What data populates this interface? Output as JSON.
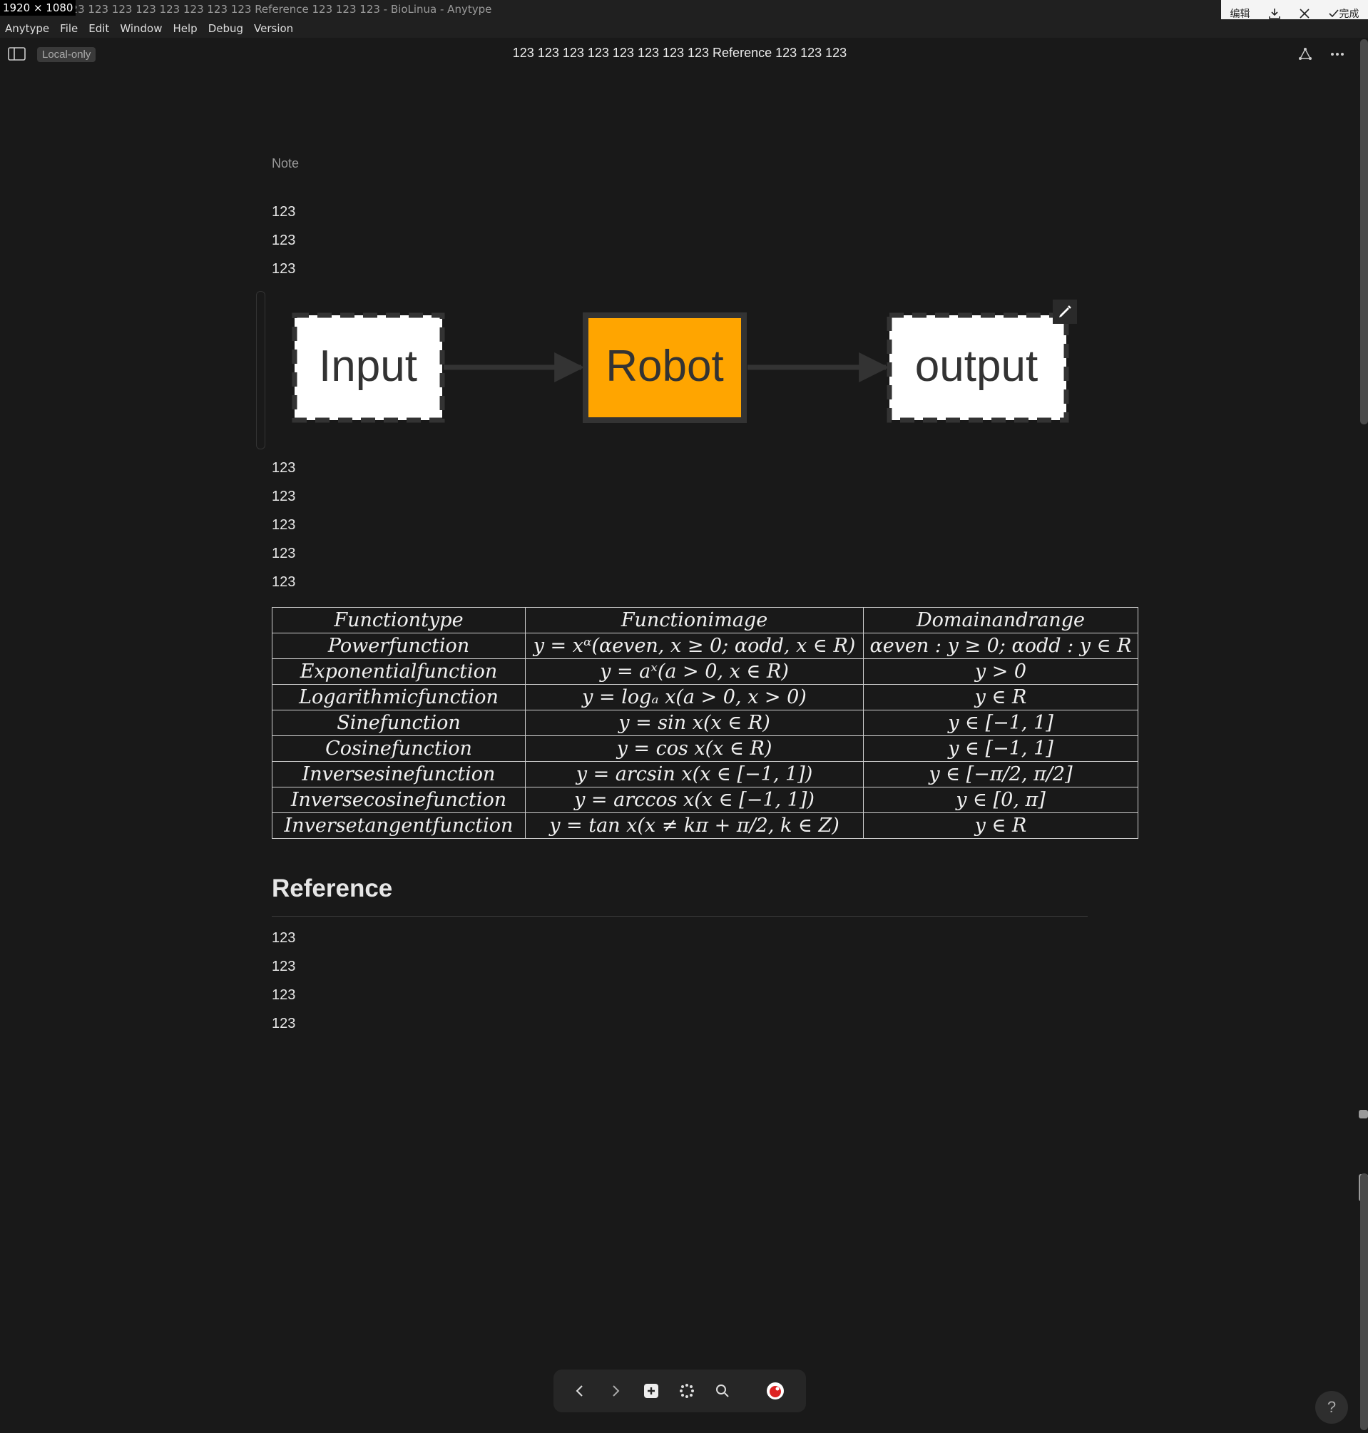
{
  "window": {
    "dimensions_badge": "1920 × 1080",
    "title": "123 123 123 123 123 123 123 123 Reference 123 123 123 - BioLinua - Anytype"
  },
  "capture_toolbar": {
    "edit": "编辑",
    "done": "完成"
  },
  "menu": [
    "Anytype",
    "File",
    "Edit",
    "Window",
    "Help",
    "Debug",
    "Version"
  ],
  "header": {
    "local_badge": "Local-only",
    "title": "123 123 123 123 123 123 123 123 Reference 123 123 123"
  },
  "body": {
    "note_label": "Note",
    "lines_top": [
      "123",
      "123",
      "123"
    ],
    "diagram": {
      "nodes": [
        {
          "label": "Input",
          "fill": "#ffffff",
          "style": "dashed"
        },
        {
          "label": "Robot",
          "fill": "#ffa500",
          "style": "solid"
        },
        {
          "label": "output",
          "fill": "#ffffff",
          "style": "dashed"
        }
      ]
    },
    "lines_mid": [
      "123",
      "123",
      "123",
      "123",
      "123"
    ],
    "table": {
      "header": [
        "Functiontype",
        "Functionimage",
        "Domainandrange"
      ],
      "rows": [
        [
          "Powerfunction",
          "y = xᵅ(αeven, x ≥ 0; αodd, x ∈ R)",
          "αeven : y ≥ 0; αodd : y ∈ R"
        ],
        [
          "Exponentialfunction",
          "y = aˣ(a > 0, x ∈ R)",
          "y > 0"
        ],
        [
          "Logarithmicfunction",
          "y = logₐ x(a > 0, x > 0)",
          "y ∈ R"
        ],
        [
          "Sinefunction",
          "y = sin x(x ∈ R)",
          "y ∈ [−1, 1]"
        ],
        [
          "Cosinefunction",
          "y = cos x(x ∈ R)",
          "y ∈ [−1, 1]"
        ],
        [
          "Inversesinefunction",
          "y = arcsin x(x ∈ [−1, 1])",
          "y ∈ [−π/2, π/2]"
        ],
        [
          "Inversecosinefunction",
          "y = arccos x(x ∈ [−1, 1])",
          "y ∈ [0, π]"
        ],
        [
          "Inversetangentfunction",
          "y = tan x(x ≠ kπ + π/2, k ∈ Z)",
          "y ∈ R"
        ]
      ]
    },
    "reference_heading": "Reference",
    "lines_ref": [
      "123",
      "123",
      "123",
      "123"
    ]
  },
  "help_label": "?"
}
